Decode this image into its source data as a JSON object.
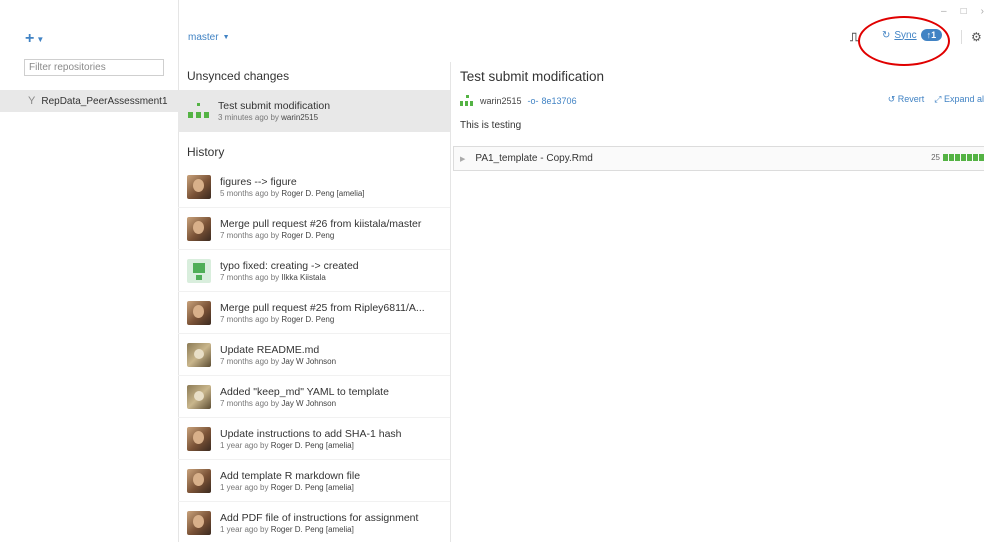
{
  "sidebar": {
    "add_label": "+",
    "filter_placeholder": "Filter repositories",
    "repo_name": "RepData_PeerAssessment1"
  },
  "header": {
    "branch": "master",
    "sync_label": "Sync",
    "sync_count": "1"
  },
  "unsynced": {
    "section_title": "Unsynced changes",
    "item_title": "Test submit modification",
    "item_meta_prefix": "3 minutes ago by ",
    "item_author": "warin2515"
  },
  "history": {
    "section_title": "History",
    "commits": [
      {
        "title": "figures --> figure",
        "time": "5 months ago by ",
        "author": "Roger D. Peng [amelia]"
      },
      {
        "title": "Merge pull request #26 from kiistala/master",
        "time": "7 months ago by ",
        "author": "Roger D. Peng"
      },
      {
        "title": "typo fixed: creating -> created",
        "time": "7 months ago by ",
        "author": "Ilkka Kiistala"
      },
      {
        "title": "Merge pull request #25 from Ripley6811/A...",
        "time": "7 months ago by ",
        "author": "Roger D. Peng"
      },
      {
        "title": "Update README.md",
        "time": "7 months ago by ",
        "author": "Jay W Johnson"
      },
      {
        "title": "Added \"keep_md\" YAML to template",
        "time": "7 months ago by ",
        "author": "Jay W Johnson"
      },
      {
        "title": "Update instructions to add SHA-1 hash",
        "time": "1 year ago by ",
        "author": "Roger D. Peng [amelia]"
      },
      {
        "title": "Add template R markdown file",
        "time": "1 year ago by ",
        "author": "Roger D. Peng [amelia]"
      },
      {
        "title": "Add PDF file of instructions for assignment",
        "time": "1 year ago by ",
        "author": "Roger D. Peng [amelia]"
      }
    ]
  },
  "detail": {
    "title": "Test submit modification",
    "author": "warin2515",
    "sha": "8e13706",
    "revert_label": "Revert",
    "expand_label": "Expand al",
    "description": "This is testing",
    "file_name": "PA1_template - Copy.Rmd",
    "file_changes": "25"
  },
  "colors": {
    "accent": "#4183c4",
    "added": "#54b344",
    "highlight_ring": "#e00000"
  }
}
